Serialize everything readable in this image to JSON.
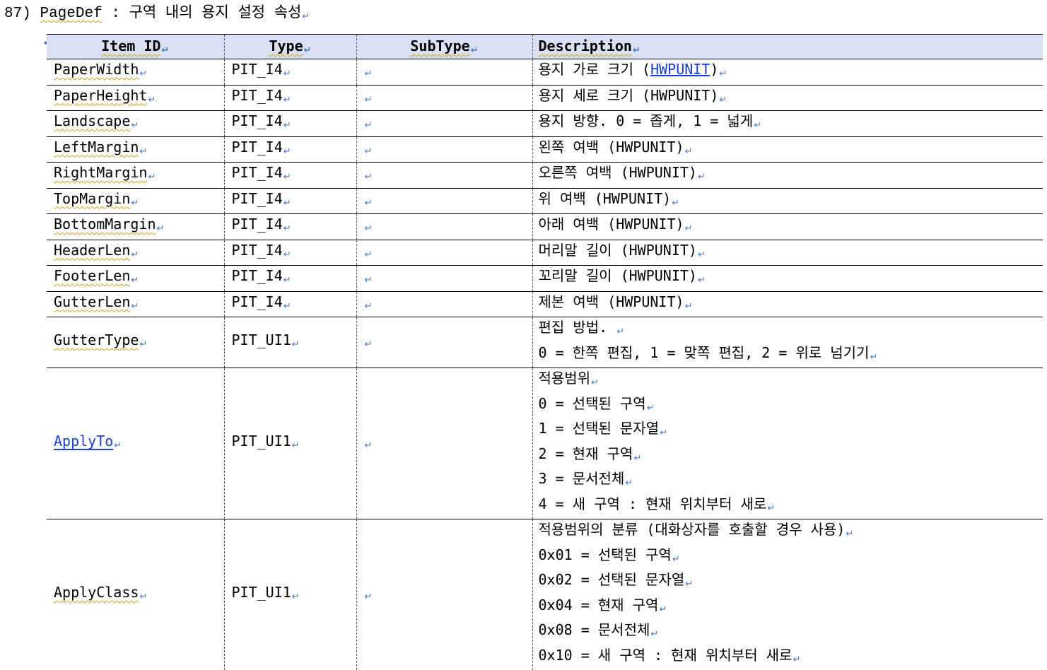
{
  "heading": {
    "number": "87)",
    "name": "PageDef",
    "colon": ":",
    "korean": "구역 내의 용지 설정 속성"
  },
  "table": {
    "headers": [
      "Item ID",
      "Type",
      "SubType",
      "Description"
    ],
    "rows": [
      {
        "id": "PaperWidth",
        "type": "PIT_I4",
        "subtype": "",
        "desc_pre": "용지 가로 크기 (",
        "desc_link": "HWPUNIT",
        "desc_post": ")"
      },
      {
        "id": "PaperHeight",
        "type": "PIT_I4",
        "subtype": "",
        "desc": [
          "용지 세로 크기 (HWPUNIT)"
        ]
      },
      {
        "id": "Landscape",
        "type": "PIT_I4",
        "subtype": "",
        "desc": [
          "용지 방향. 0 = 좁게, 1 = 넓게"
        ]
      },
      {
        "id": "LeftMargin",
        "type": "PIT_I4",
        "subtype": "",
        "desc": [
          "왼쪽 여백 (HWPUNIT)"
        ]
      },
      {
        "id": "RightMargin",
        "type": "PIT_I4",
        "subtype": "",
        "desc": [
          "오른쪽 여백 (HWPUNIT)"
        ]
      },
      {
        "id": "TopMargin",
        "type": "PIT_I4",
        "subtype": "",
        "desc": [
          "위 여백 (HWPUNIT)"
        ]
      },
      {
        "id": "BottomMargin",
        "type": "PIT_I4",
        "subtype": "",
        "desc": [
          "아래 여백 (HWPUNIT)"
        ]
      },
      {
        "id": "HeaderLen",
        "type": "PIT_I4",
        "subtype": "",
        "desc": [
          "머리말 길이 (HWPUNIT)"
        ]
      },
      {
        "id": "FooterLen",
        "type": "PIT_I4",
        "subtype": "",
        "desc": [
          "꼬리말 길이 (HWPUNIT)"
        ]
      },
      {
        "id": "GutterLen",
        "type": "PIT_I4",
        "subtype": "",
        "desc": [
          "제본 여백 (HWPUNIT)"
        ]
      },
      {
        "id": "GutterType",
        "type": "PIT_UI1",
        "subtype": "",
        "desc": [
          "편집 방법. ",
          "0 = 한쪽 편집, 1 = 맞쪽 편집, 2 = 위로 넘기기"
        ]
      },
      {
        "id": "ApplyTo",
        "type": "PIT_UI1",
        "subtype": "",
        "desc": [
          "적용범위",
          "0 = 선택된 구역",
          "1 = 선택된 문자열",
          "2 = 현재 구역",
          "3 = 문서전체",
          "4 = 새 구역 : 현재 위치부터 새로"
        ]
      },
      {
        "id": "ApplyClass",
        "type": "PIT_UI1",
        "subtype": "",
        "desc": [
          "적용범위의 분류 (대화상자를 호출할 경우 사용)",
          "0x01 = 선택된 구역",
          "0x02 = 선택된 문자열",
          "0x04 = 현재 구역",
          "0x08 = 문서전체",
          "0x10 = 새 구역 : 현재 위치부터 새로"
        ]
      }
    ]
  },
  "marks": {
    "paragraph": "↵",
    "anchor": "◆"
  },
  "colors": {
    "header_bg": "#dae1f5",
    "link": "#1a3fd8",
    "mark": "#4a78c8"
  }
}
